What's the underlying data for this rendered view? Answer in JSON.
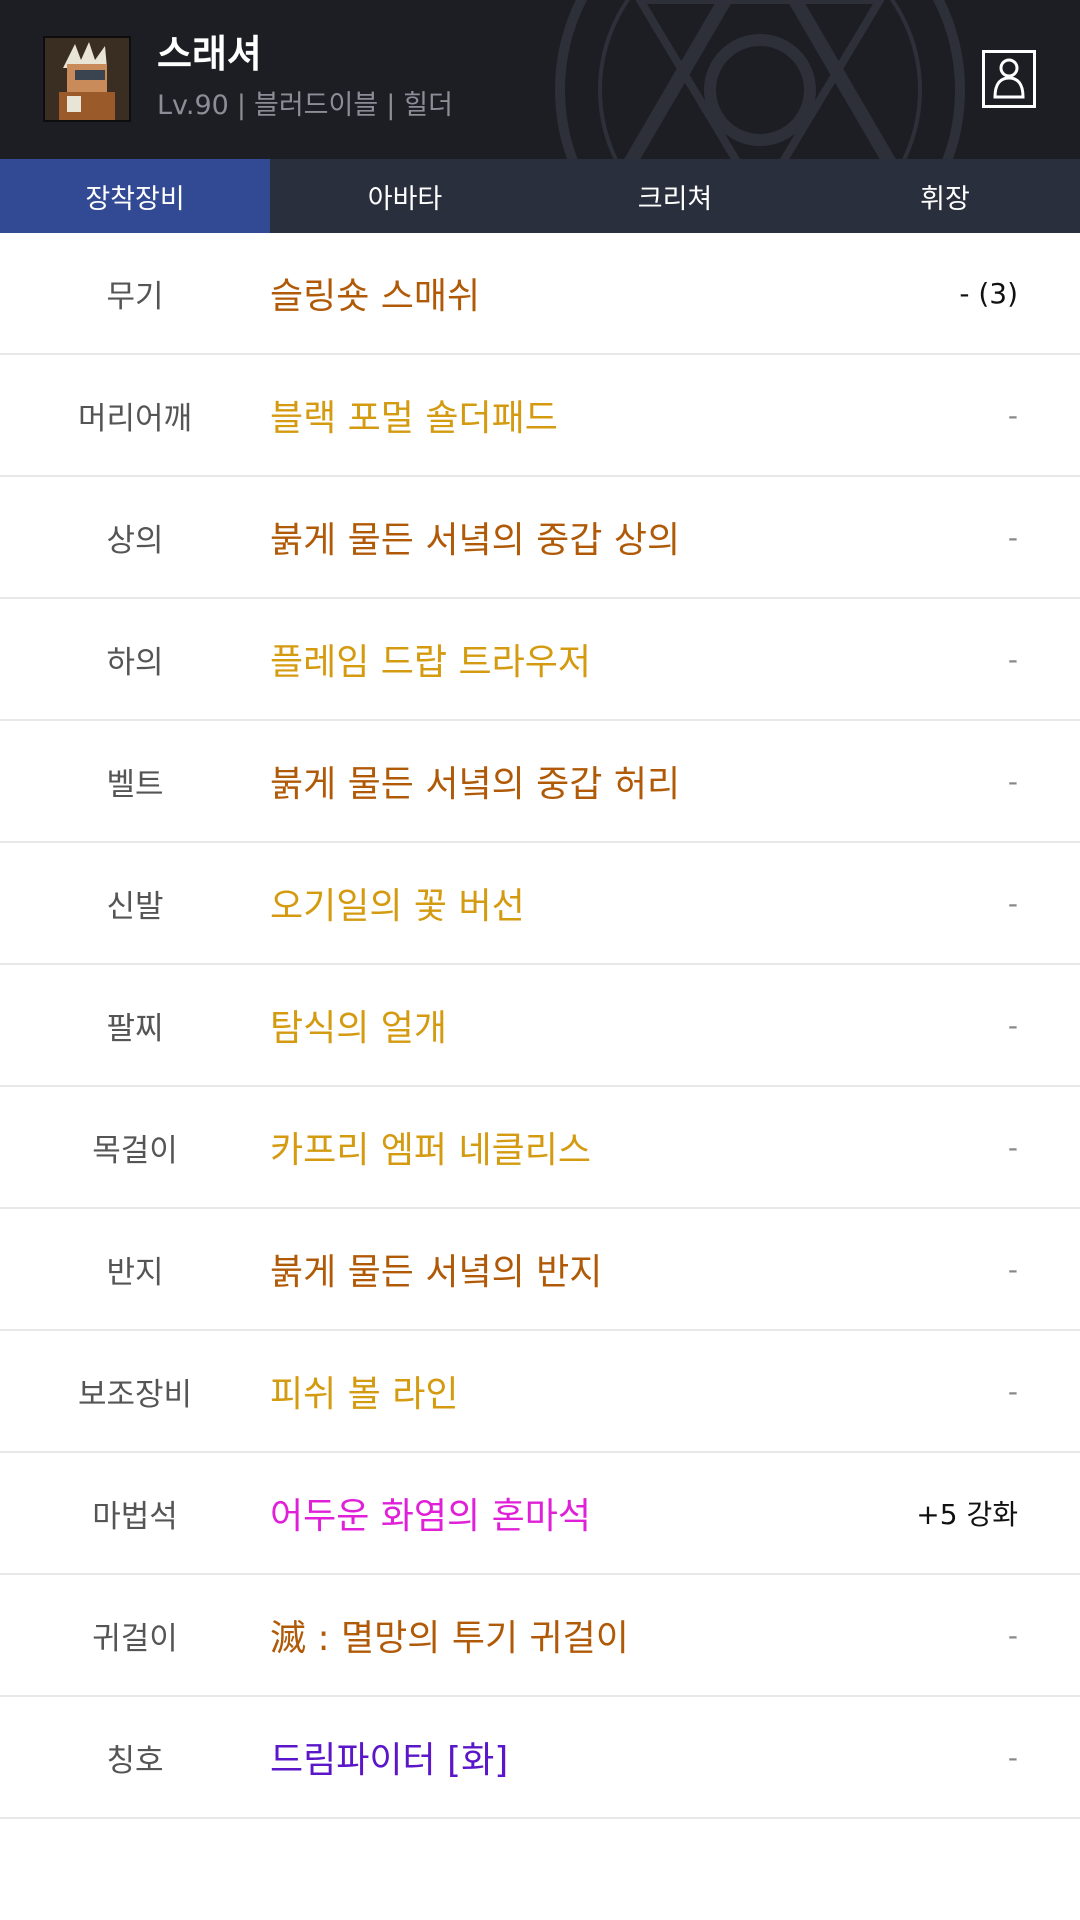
{
  "header": {
    "character_name": "스래셔",
    "level": "Lv.90",
    "guild": "블러드이블",
    "server": "힐더",
    "separator": "|",
    "profile_icon": "person-icon"
  },
  "tabs": [
    {
      "label": "장착장비",
      "active": true
    },
    {
      "label": "아바타",
      "active": false
    },
    {
      "label": "크리쳐",
      "active": false
    },
    {
      "label": "휘장",
      "active": false
    }
  ],
  "equipment": [
    {
      "slot": "무기",
      "item": "슬링숏 스매쉬",
      "color": "#b05a08",
      "extra": "- (3)"
    },
    {
      "slot": "머리어깨",
      "item": "블랙 포멀 숄더패드",
      "color": "#d49a10",
      "extra": "-"
    },
    {
      "slot": "상의",
      "item": "붉게 물든 서녘의 중갑 상의",
      "color": "#b05a08",
      "extra": "-"
    },
    {
      "slot": "하의",
      "item": "플레임 드랍 트라우저",
      "color": "#d49a10",
      "extra": "-"
    },
    {
      "slot": "벨트",
      "item": "붉게 물든 서녘의 중갑 허리",
      "color": "#b05a08",
      "extra": "-"
    },
    {
      "slot": "신발",
      "item": "오기일의 꽃 버선",
      "color": "#d49a10",
      "extra": "-"
    },
    {
      "slot": "팔찌",
      "item": "탐식의 얼개",
      "color": "#d49a10",
      "extra": "-"
    },
    {
      "slot": "목걸이",
      "item": "카프리 엠퍼 네클리스",
      "color": "#d49a10",
      "extra": "-"
    },
    {
      "slot": "반지",
      "item": "붉게 물든 서녘의 반지",
      "color": "#b05a08",
      "extra": "-"
    },
    {
      "slot": "보조장비",
      "item": "피쉬 볼 라인",
      "color": "#d49a10",
      "extra": "-"
    },
    {
      "slot": "마법석",
      "item": "어두운 화염의 혼마석",
      "color": "#e020d8",
      "extra": "+5 강화"
    },
    {
      "slot": "귀걸이",
      "item": "滅 : 멸망의 투기 귀걸이",
      "color": "#b05a08",
      "extra": "-"
    },
    {
      "slot": "칭호",
      "item": "드림파이터 [화]",
      "color": "#5a16c8",
      "extra": "-"
    }
  ]
}
